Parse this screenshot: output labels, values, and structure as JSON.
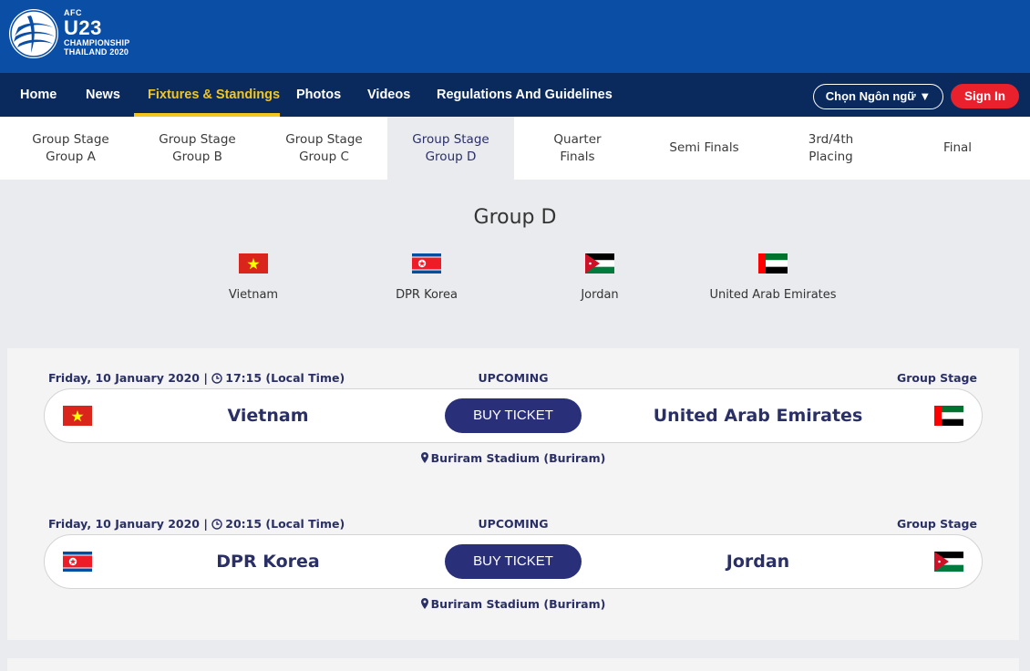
{
  "logo": {
    "afc": "AFC",
    "u23": "U23",
    "championship": "CHAMPIONSHIP",
    "edition": "THAILAND 2020"
  },
  "nav": {
    "items": [
      "Home",
      "News",
      "Fixtures & Standings",
      "Photos",
      "Videos",
      "Regulations And Guidelines"
    ],
    "active": "Fixtures & Standings",
    "language_label": "Chọn Ngôn ngữ ▼",
    "signin_label": "Sign In"
  },
  "stage_tabs": [
    {
      "line1": "Group Stage",
      "line2": "Group A"
    },
    {
      "line1": "Group Stage",
      "line2": "Group B"
    },
    {
      "line1": "Group Stage",
      "line2": "Group C"
    },
    {
      "line1": "Group Stage",
      "line2": "Group D"
    },
    {
      "line1": "Quarter",
      "line2": "Finals"
    },
    {
      "line1": "Semi Finals",
      "line2": ""
    },
    {
      "line1": "3rd/4th",
      "line2": "Placing"
    },
    {
      "line1": "Final",
      "line2": ""
    }
  ],
  "active_tab": "Group D",
  "group": {
    "title": "Group D",
    "teams": [
      "Vietnam",
      "DPR Korea",
      "Jordan",
      "United Arab Emirates"
    ]
  },
  "fixtures": [
    {
      "date": "Friday, 10 January 2020 |",
      "time": "17:15 (Local Time)",
      "status": "UPCOMING",
      "stage": "Group Stage",
      "home": "Vietnam",
      "away": "United Arab Emirates",
      "button": "BUY TICKET",
      "venue": "Buriram Stadium (Buriram)"
    },
    {
      "date": "Friday, 10 January 2020 |",
      "time": "20:15 (Local Time)",
      "status": "UPCOMING",
      "stage": "Group Stage",
      "home": "DPR Korea",
      "away": "Jordan",
      "button": "BUY TICKET",
      "venue": "Buriram Stadium (Buriram)"
    }
  ],
  "colors": {
    "header": "#0a4ea6",
    "nav": "#0a2a5e",
    "accent": "#f4c51a",
    "signin": "#e8212d",
    "button": "#2a2f7a",
    "text": "#2a2f66"
  }
}
